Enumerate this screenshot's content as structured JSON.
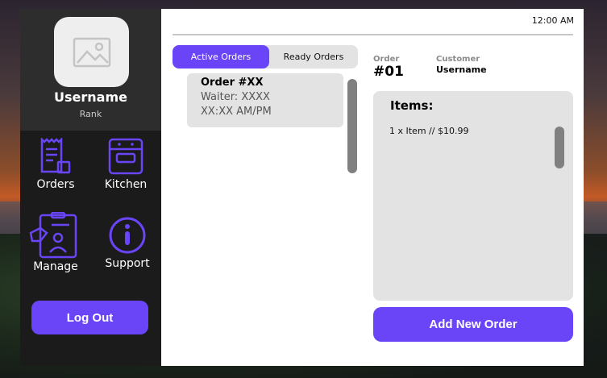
{
  "sidebar": {
    "username": "Username",
    "rank": "Rank",
    "nav": [
      {
        "label": "Orders",
        "icon": "receipt-icon"
      },
      {
        "label": "Kitchen",
        "icon": "oven-icon"
      },
      {
        "label": "Manage",
        "icon": "clipboard-user-icon"
      },
      {
        "label": "Support",
        "icon": "info-icon"
      }
    ],
    "logout_label": "Log Out"
  },
  "header": {
    "time": "12:00 AM"
  },
  "tabs": {
    "active": "Active Orders",
    "ready": "Ready Orders"
  },
  "orders": [
    {
      "id": "Order #XX",
      "waiter": "Waiter: XXXX",
      "time": "XX:XX AM/PM"
    }
  ],
  "detail": {
    "order_label": "Order",
    "order_number": "#01",
    "customer_label": "Customer",
    "customer_name": "Username",
    "items_title": "Items:",
    "items": [
      "1 x Item // $10.99"
    ]
  },
  "add_order_label": "Add New Order",
  "colors": {
    "accent": "#6a45f7",
    "sidebar": "#1b1b1b",
    "panel": "#e3e3e3"
  }
}
